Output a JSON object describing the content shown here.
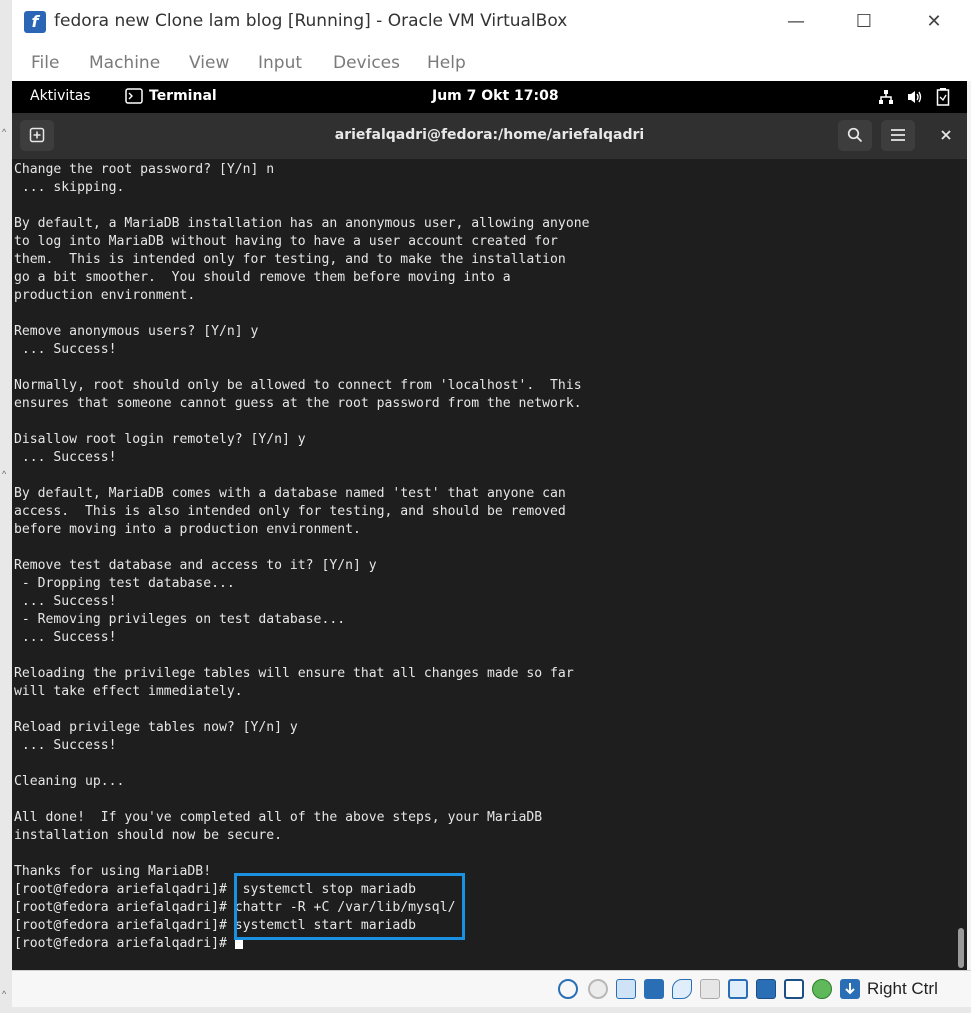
{
  "window": {
    "title": "fedora new Clone lam blog [Running] - Oracle VM VirtualBox",
    "app_icon_glyph": "f",
    "minimize_glyph": "—",
    "maximize_glyph": "☐",
    "close_glyph": "✕"
  },
  "menu": {
    "items": [
      "File",
      "Machine",
      "View",
      "Input",
      "Devices",
      "Help"
    ]
  },
  "gnome_top_bar": {
    "activities": "Aktivitas",
    "app_name": "Terminal",
    "clock": "Jum 7 Okt  17:08",
    "tray_icons": [
      "network-icon",
      "volume-icon",
      "battery-icon"
    ]
  },
  "terminal": {
    "title": "ariefalqadri@fedora:/home/ariefalqadri",
    "new_tab_glyph": "⊞",
    "search_glyph": "⚲",
    "menu_glyph": "☰",
    "close_glyph": "✕",
    "lines": [
      "Change the root password? [Y/n] n",
      " ... skipping.",
      "",
      "By default, a MariaDB installation has an anonymous user, allowing anyone",
      "to log into MariaDB without having to have a user account created for",
      "them.  This is intended only for testing, and to make the installation",
      "go a bit smoother.  You should remove them before moving into a",
      "production environment.",
      "",
      "Remove anonymous users? [Y/n] y",
      " ... Success!",
      "",
      "Normally, root should only be allowed to connect from 'localhost'.  This",
      "ensures that someone cannot guess at the root password from the network.",
      "",
      "Disallow root login remotely? [Y/n] y",
      " ... Success!",
      "",
      "By default, MariaDB comes with a database named 'test' that anyone can",
      "access.  This is also intended only for testing, and should be removed",
      "before moving into a production environment.",
      "",
      "Remove test database and access to it? [Y/n] y",
      " - Dropping test database...",
      " ... Success!",
      " - Removing privileges on test database...",
      " ... Success!",
      "",
      "Reloading the privilege tables will ensure that all changes made so far",
      "will take effect immediately.",
      "",
      "Reload privilege tables now? [Y/n] y",
      " ... Success!",
      "",
      "Cleaning up...",
      "",
      "All done!  If you've completed all of the above steps, your MariaDB",
      "installation should now be secure.",
      "",
      "Thanks for using MariaDB!",
      "[root@fedora ariefalqadri]#  systemctl stop mariadb",
      "[root@fedora ariefalqadri]# chattr -R +C /var/lib/mysql/",
      "[root@fedora ariefalqadri]# systemctl start mariadb"
    ],
    "prompt": "[root@fedora ariefalqadri]# ",
    "highlight_color": "#1b8fe0"
  },
  "statusbar": {
    "host_key": "Right Ctrl",
    "icons": [
      "harddisk-icon",
      "optical-drive-icon",
      "audio-icon",
      "network-adapter-icon",
      "usb-icon",
      "shared-folder-icon",
      "display-icon",
      "recording-icon",
      "virtualization-icon",
      "guest-additions-icon",
      "host-key-arrow-icon"
    ]
  }
}
